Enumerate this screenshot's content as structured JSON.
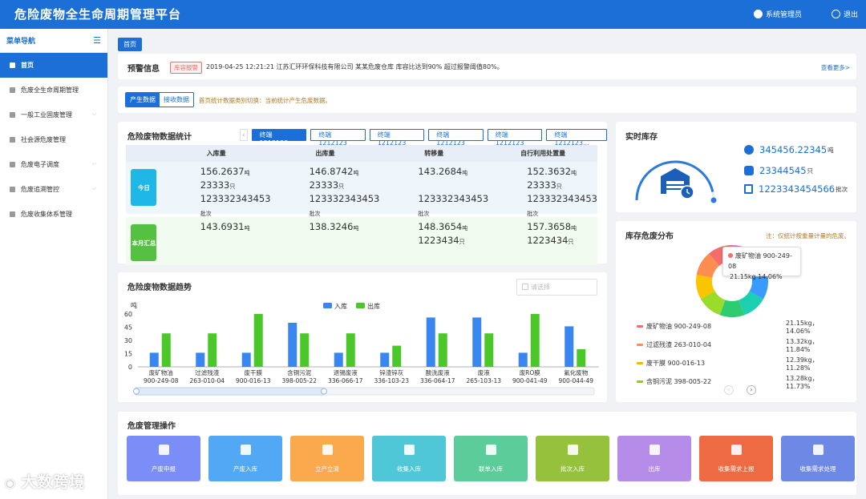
{
  "header": {
    "title": "危险废物全生命周期管理平台",
    "user": "系统管理员",
    "logout": "退出"
  },
  "sidebar": {
    "title": "菜单导航",
    "items": [
      {
        "label": "首页",
        "active": true,
        "arrow": false
      },
      {
        "label": "危废全生命周期管理",
        "arrow": false
      },
      {
        "label": "一般工业固废管理",
        "arrow": true
      },
      {
        "label": "社会源危废管理",
        "arrow": false
      },
      {
        "label": "危废电子调度",
        "arrow": true
      },
      {
        "label": "危废追溯管控",
        "arrow": true
      },
      {
        "label": "危废收集体系管理",
        "arrow": false
      }
    ]
  },
  "tab": "首页",
  "alert": {
    "title": "预警信息",
    "badge": "库容报警",
    "message": "2019-04-25 12:21:21 江苏汇环环保科技有限公司 某某危废仓库 库容比达到90% 超过报警阈值80%。",
    "more": "查看更多>"
  },
  "switch": {
    "produce": "产生数据",
    "receive": "接收数据",
    "hint": "首页统计数据类别切换：当前统计产生危废数据。"
  },
  "stats": {
    "title": "危险废物数据统计",
    "terminals": [
      "终端1212123",
      "终端1212123",
      "终端1212123",
      "终端1212123",
      "终端1212123",
      "终端1212123..."
    ],
    "columns": [
      "入库量",
      "出库量",
      "转移量",
      "自行利用处置量"
    ],
    "today_label": "今日",
    "month_label": "本月汇总",
    "today": [
      {
        "w": "156.2637",
        "wu": "吨",
        "c": "23333",
        "cu": "只",
        "b": "123332343453",
        "bu": "批次"
      },
      {
        "w": "146.8742",
        "wu": "吨",
        "c": "23333",
        "cu": "只",
        "b": "123332343453",
        "bu": "批次"
      },
      {
        "w": "143.2684",
        "wu": "吨",
        "c": "",
        "cu": "",
        "b": "123332343453",
        "bu": "批次"
      },
      {
        "w": "152.3632",
        "wu": "吨",
        "c": "23333",
        "cu": "只",
        "b": "123332343453",
        "bu": "批次"
      }
    ],
    "month": [
      {
        "w": "143.6931",
        "wu": "吨",
        "c": "",
        "cu": ""
      },
      {
        "w": "138.3246",
        "wu": "吨",
        "c": "",
        "cu": ""
      },
      {
        "w": "148.3654",
        "wu": "吨",
        "c": "1223434",
        "cu": "只"
      },
      {
        "w": "157.3658",
        "wu": "吨",
        "c": "1223434",
        "cu": "只"
      }
    ]
  },
  "stock": {
    "title": "实时库存",
    "v1": "345456.22345",
    "u1": "吨",
    "v2": "23344545",
    "u2": "只",
    "v3": "1223343454566",
    "u3": "批次"
  },
  "dist": {
    "title": "库存危废分布",
    "note": "注：仅统计按重量计量的危废。",
    "tooltip_name": "废矿物油 900-249-08",
    "tooltip_val": "21.15kg 14.06%",
    "legend": [
      {
        "name": "废矿物油 900-249-08",
        "value": "21.15kg，14.06%",
        "color": "#f56c6c"
      },
      {
        "name": "过滤残渣 263-010-04",
        "value": "13.32kg，11.84%",
        "color": "#ff8c50"
      },
      {
        "name": "废干膜 900-016-13",
        "value": "12.39kg，11.28%",
        "color": "#f5b800"
      },
      {
        "name": "含铜污泥 398-005-22",
        "value": "13.28kg，11.73%",
        "color": "#8fd400"
      }
    ],
    "colors": [
      "#e86fd0",
      "#4fc3f7",
      "#3a9bff",
      "#1ccfb0",
      "#2ecc71",
      "#9bdb2a",
      "#f9c400",
      "#ff8c50",
      "#f56c6c"
    ]
  },
  "trend": {
    "title": "危险废物数据趋势",
    "date_placeholder": "请选择"
  },
  "chart_data": {
    "type": "bar",
    "ylabel": "吨",
    "ylim": [
      0,
      60
    ],
    "yticks": [
      0,
      15,
      30,
      45,
      60
    ],
    "categories": [
      {
        "l1": "废矿物油",
        "l2": "900-249-08"
      },
      {
        "l1": "过滤残渣",
        "l2": "263-010-04"
      },
      {
        "l1": "废干膜",
        "l2": "900-016-13"
      },
      {
        "l1": "含铜污泥",
        "l2": "398-005-22"
      },
      {
        "l1": "退锡废液",
        "l2": "336-066-17"
      },
      {
        "l1": "锌渣锌灰",
        "l2": "336-103-23"
      },
      {
        "l1": "酸洗废液",
        "l2": "336-064-17"
      },
      {
        "l1": "废液",
        "l2": "265-103-13"
      },
      {
        "l1": "废RO膜",
        "l2": "900-041-49"
      },
      {
        "l1": "氟化废物",
        "l2": "900-044-49"
      }
    ],
    "series": [
      {
        "name": "入库",
        "color": "#3a86f0",
        "values": [
          16,
          16,
          16,
          50,
          16,
          16,
          56,
          56,
          16,
          46
        ]
      },
      {
        "name": "出库",
        "color": "#4cc72a",
        "values": [
          38,
          38,
          60,
          38,
          38,
          24,
          38,
          38,
          60,
          20
        ]
      }
    ]
  },
  "ops": {
    "title": "危废管理操作",
    "items": [
      {
        "label": "产废申报",
        "color": "#7b8ef7"
      },
      {
        "label": "产废入库",
        "color": "#52a8f5"
      },
      {
        "label": "立产立清",
        "color": "#fba94d"
      },
      {
        "label": "收集入库",
        "color": "#4fc7d6"
      },
      {
        "label": "联单入库",
        "color": "#5ccd9a"
      },
      {
        "label": "批次入库",
        "color": "#96c13d"
      },
      {
        "label": "出库",
        "color": "#b58de8"
      },
      {
        "label": "收集需求上报",
        "color": "#ee6a42"
      },
      {
        "label": "收集需求处理",
        "color": "#6e88e6"
      }
    ]
  },
  "watermark": "大数跨境"
}
